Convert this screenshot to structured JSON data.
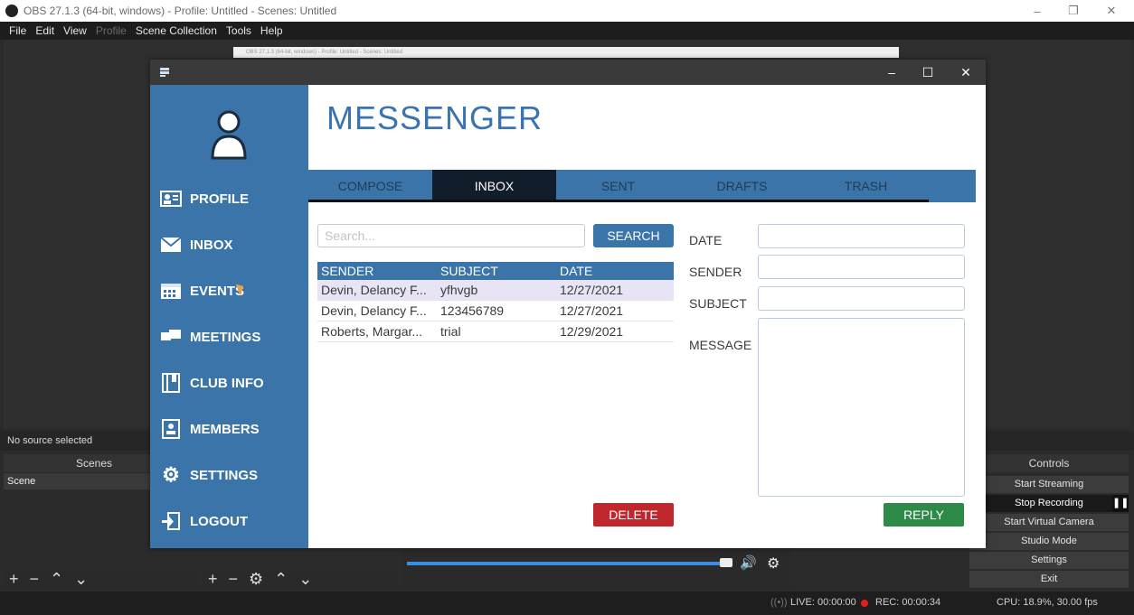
{
  "obs": {
    "title": "OBS 27.1.3 (64-bit, windows) - Profile: Untitled - Scenes: Untitled",
    "menu": [
      "File",
      "Edit",
      "View",
      "Profile",
      "Scene Collection",
      "Tools",
      "Help"
    ],
    "mini_title": "OBS 27.1.3 (64-bit, windows) - Profile: Untitled - Scenes: Untitled",
    "no_source": "No source selected",
    "scenes_header": "Scenes",
    "scene_item": "Scene",
    "controls_header": "Controls",
    "controls": [
      "Start Streaming",
      "Stop Recording",
      "Start Virtual Camera",
      "Studio Mode",
      "Settings",
      "Exit"
    ],
    "status": {
      "live": "LIVE: 00:00:00",
      "rec": "REC: 00:00:34",
      "cpu": "CPU: 18.9%, 30.00 fps"
    },
    "window_controls": {
      "minimize": "–",
      "restore": "❐",
      "close": "✕"
    }
  },
  "app": {
    "title": "MESSENGER",
    "window_controls": {
      "minimize": "–",
      "maximize": "☐",
      "close": "✕"
    },
    "nav": [
      {
        "label": "PROFILE",
        "icon": "profile-card-icon"
      },
      {
        "label": "INBOX",
        "icon": "envelope-icon"
      },
      {
        "label": "EVENTS",
        "icon": "calendar-icon"
      },
      {
        "label": "MEETINGS",
        "icon": "chat-bubbles-icon"
      },
      {
        "label": "CLUB INFO",
        "icon": "notebook-icon"
      },
      {
        "label": "MEMBERS",
        "icon": "member-badge-icon"
      },
      {
        "label": "SETTINGS",
        "icon": "gear-icon"
      },
      {
        "label": "LOGOUT",
        "icon": "logout-icon"
      }
    ],
    "tabs": [
      "COMPOSE",
      "INBOX",
      "SENT",
      "DRAFTS",
      "TRASH"
    ],
    "active_tab": "INBOX",
    "search": {
      "placeholder": "Search...",
      "button": "SEARCH"
    },
    "table": {
      "headers": [
        "SENDER",
        "SUBJECT",
        "DATE"
      ],
      "rows": [
        {
          "sender": "Devin, Delancy F...",
          "subject": "yfhvgb",
          "date": "12/27/2021",
          "selected": true
        },
        {
          "sender": "Devin, Delancy F...",
          "subject": "123456789",
          "date": "12/27/2021",
          "selected": false
        },
        {
          "sender": "Roberts, Margar...",
          "subject": "trial",
          "date": "12/29/2021",
          "selected": false
        }
      ]
    },
    "detail": {
      "date_label": "DATE",
      "sender_label": "SENDER",
      "subject_label": "SUBJECT",
      "message_label": "MESSAGE"
    },
    "buttons": {
      "delete": "DELETE",
      "reply": "REPLY"
    },
    "colors": {
      "primary": "#3b74a8",
      "delete": "#c0272d",
      "reply": "#2e8b47",
      "active_tab": "#111d2b"
    }
  }
}
